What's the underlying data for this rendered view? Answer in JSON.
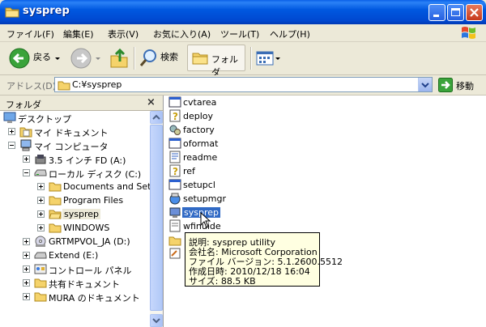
{
  "window": {
    "title": "sysprep"
  },
  "menu": [
    "ファイル(F)",
    "編集(E)",
    "表示(V)",
    "お気に入り(A)",
    "ツール(T)",
    "ヘルプ(H)"
  ],
  "toolbar": {
    "back": "戻る",
    "search": "検索",
    "folders": "フォルダ"
  },
  "address": {
    "label": "アドレス(D)",
    "value": "C:¥sysprep",
    "go": "移動"
  },
  "folder_pane": {
    "title": "フォルダ",
    "tree": [
      {
        "label": "デスクトップ",
        "icon": "desktop-icon"
      },
      {
        "label": "マイ ドキュメント",
        "icon": "my-documents-icon"
      },
      {
        "label": "マイ コンピュータ",
        "icon": "my-computer-icon"
      },
      {
        "label": "3.5 インチ FD (A:)",
        "icon": "floppy-icon"
      },
      {
        "label": "ローカル ディスク (C:)",
        "icon": "hard-disk-icon"
      },
      {
        "label": "Documents and Setti",
        "icon": "folder-icon"
      },
      {
        "label": "Program Files",
        "icon": "folder-icon"
      },
      {
        "label": "sysprep",
        "icon": "folder-icon",
        "selected": true
      },
      {
        "label": "WINDOWS",
        "icon": "folder-icon"
      },
      {
        "label": "GRTMPVOL_JA (D:)",
        "icon": "cd-drive-icon"
      },
      {
        "label": "Extend (E:)",
        "icon": "drive-icon"
      },
      {
        "label": "コントロール パネル",
        "icon": "control-panel-icon"
      },
      {
        "label": "共有ドキュメント",
        "icon": "folder-icon"
      },
      {
        "label": "MURA のドキュメント",
        "icon": "folder-icon"
      }
    ]
  },
  "files": [
    {
      "name": "cvtarea",
      "icon": "exe-window-icon"
    },
    {
      "name": "deploy",
      "icon": "help-file-icon"
    },
    {
      "name": "factory",
      "icon": "gears-exe-icon"
    },
    {
      "name": "oformat",
      "icon": "exe-window-icon"
    },
    {
      "name": "readme",
      "icon": "text-file-icon"
    },
    {
      "name": "ref",
      "icon": "help-file-icon"
    },
    {
      "name": "setupcl",
      "icon": "exe-window-icon"
    },
    {
      "name": "setupmgr",
      "icon": "setup-icon"
    },
    {
      "name": "sysprep",
      "icon": "sysprep-exe-icon",
      "selected": true
    },
    {
      "name": "wfinuide",
      "icon": "doc-icon"
    }
  ],
  "tooltip": {
    "description": "説明: sysprep utility",
    "company": "会社名: Microsoft Corporation",
    "version": "ファイル バージョン: 5.1.2600.5512",
    "created": "作成日時: 2010/12/18 16:04",
    "size": "サイズ: 88.5 KB"
  },
  "colors": {
    "title_bar": "#0058e0",
    "selection": "#316ac5",
    "tooltip_bg": "#ffffe1"
  }
}
